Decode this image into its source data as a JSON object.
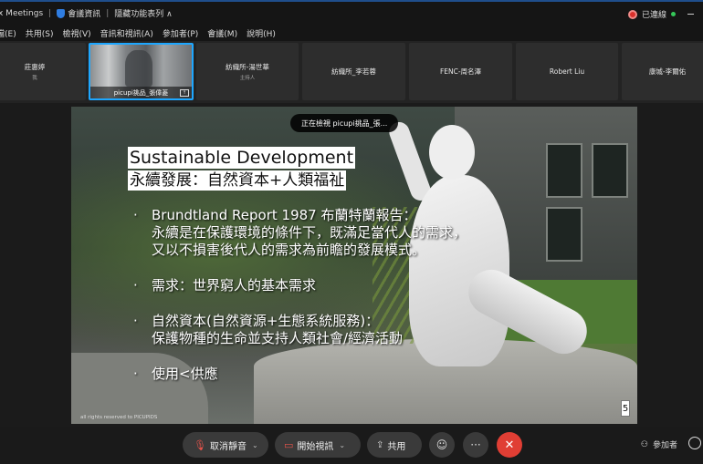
{
  "titlebar": {
    "app_title": "x Meetings",
    "meeting_info": "會議資訊",
    "hide_controls": "隱藏功能表列 ∧",
    "status": "已連線"
  },
  "menu": [
    "檔(E)",
    "共用(S)",
    "檢視(V)",
    "音訊和視訊(A)",
    "參加者(P)",
    "會議(M)",
    "說明(H)"
  ],
  "participants": [
    {
      "name": "莊惠婷",
      "sub": "我"
    },
    {
      "name": "picupi挑品_張偉菱",
      "sub": ""
    },
    {
      "name": "紡織所-湯世華",
      "sub": "主持人"
    },
    {
      "name": "紡織所_李若蓉",
      "sub": ""
    },
    {
      "name": "FENC-周名澤",
      "sub": ""
    },
    {
      "name": "Robert Liu",
      "sub": ""
    },
    {
      "name": "康城-李爾佑",
      "sub": ""
    }
  ],
  "viewing_label": "正在檢視 picupi挑品_張...",
  "slide": {
    "title": "Sustainable Development",
    "subtitle": "永續發展：自然資本+人類福祉",
    "bullets": [
      [
        "Brundtland Report 1987 布蘭特蘭報告：",
        "永續是在保護環境的條件下，既滿足當代人的需求，",
        "又以不損害後代人的需求為前瞻的發展模式。"
      ],
      [
        "需求：世界窮人的基本需求"
      ],
      [
        "自然資本(自然資源+生態系統服務)：",
        "保護物種的生命並支持人類社會/經濟活動"
      ],
      [
        "使用<供應"
      ]
    ],
    "footer": "all rights reserved to  PICUPIDS",
    "page": "5"
  },
  "toolbar": {
    "mute": "取消靜音",
    "video": "開始視訊",
    "share": "共用",
    "reactions_icon": "smiley-icon",
    "more": "···",
    "end_icon": "close-icon",
    "participants": "參加者"
  }
}
